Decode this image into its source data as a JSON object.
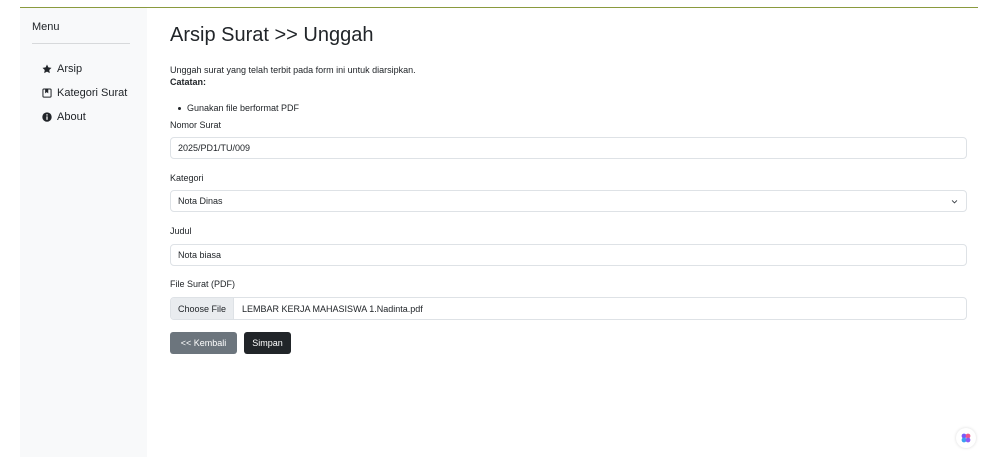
{
  "sidebar": {
    "menu_title": "Menu",
    "items": [
      {
        "label": "Arsip",
        "icon": "star-icon"
      },
      {
        "label": "Kategori Surat",
        "icon": "bookmark-icon"
      },
      {
        "label": "About",
        "icon": "info-icon"
      }
    ]
  },
  "main": {
    "title": "Arsip Surat >> Unggah",
    "description": "Unggah surat yang telah terbit pada form ini untuk diarsipkan.",
    "note_title": "Catatan:",
    "notes": [
      "Gunakan file berformat PDF"
    ]
  },
  "form": {
    "nomor_label": "Nomor Surat",
    "nomor_value": "2025/PD1/TU/009",
    "kategori_label": "Kategori",
    "kategori_value": "Nota Dinas",
    "judul_label": "Judul",
    "judul_value": "Nota biasa",
    "file_label": "File Surat (PDF)",
    "file_button": "Choose File",
    "file_name": "LEMBAR KERJA MAHASISWA 1.Nadinta.pdf"
  },
  "buttons": {
    "back": "<< Kembali",
    "save": "Simpan"
  },
  "colors": {
    "accent_line": "#8a9a3e",
    "sidebar_bg": "#f8f9fa",
    "btn_secondary": "#6c757d",
    "btn_dark": "#212529"
  }
}
